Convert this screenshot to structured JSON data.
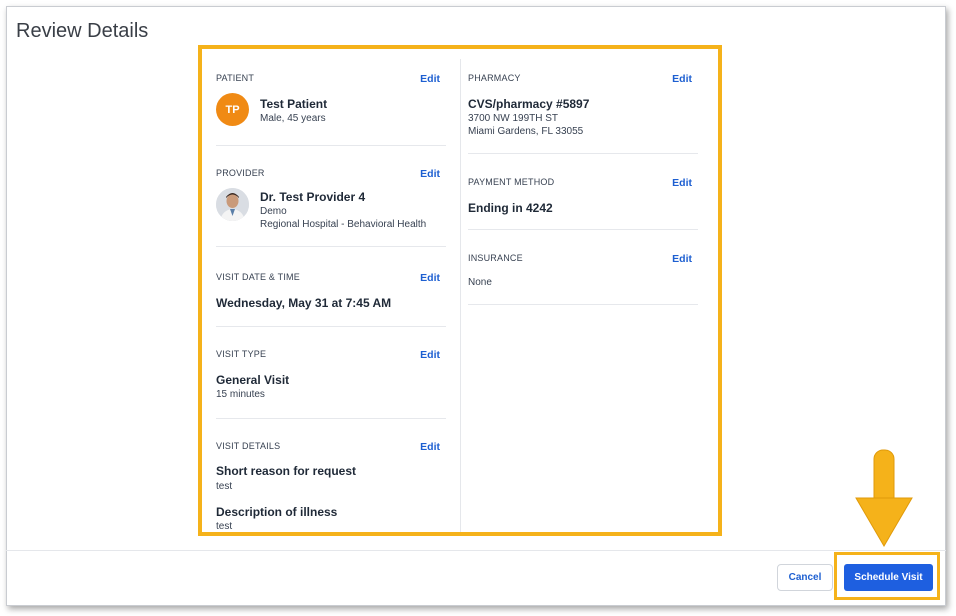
{
  "page": {
    "title": "Review Details"
  },
  "colors": {
    "highlight": "#f5b21a",
    "primary": "#1e5fe0",
    "link": "#1d5fd1",
    "avatar": "#f08a14"
  },
  "patient": {
    "label": "PATIENT",
    "edit": "Edit",
    "initials": "TP",
    "name": "Test Patient",
    "details": "Male, 45 years"
  },
  "provider": {
    "label": "PROVIDER",
    "edit": "Edit",
    "name": "Dr. Test Provider 4",
    "organization": "Demo",
    "facility": "Regional Hospital - Behavioral Health"
  },
  "visit_datetime": {
    "label": "VISIT DATE & TIME",
    "edit": "Edit",
    "value": "Wednesday, May 31 at 7:45 AM"
  },
  "visit_type": {
    "label": "VISIT TYPE",
    "edit": "Edit",
    "value": "General Visit",
    "duration": "15 minutes"
  },
  "visit_details": {
    "label": "VISIT DETAILS",
    "edit": "Edit",
    "reason_label": "Short reason for request",
    "reason_value": "test",
    "description_label": "Description of illness",
    "description_value": "test"
  },
  "pharmacy": {
    "label": "PHARMACY",
    "edit": "Edit",
    "name": "CVS/pharmacy #5897",
    "address1": "3700 NW 199TH ST",
    "address2": "Miami Gardens, FL 33055"
  },
  "payment": {
    "label": "PAYMENT METHOD",
    "edit": "Edit",
    "value": "Ending in 4242"
  },
  "insurance": {
    "label": "INSURANCE",
    "edit": "Edit",
    "value": "None"
  },
  "footer": {
    "cancel": "Cancel",
    "schedule": "Schedule Visit"
  }
}
